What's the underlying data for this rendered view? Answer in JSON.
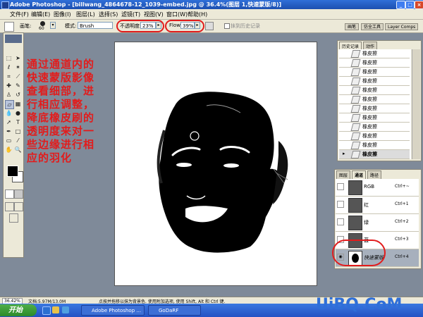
{
  "window": {
    "title": "Adobe Photoshop - [billwang_4864678-12_1039-embed.jpg @ 36.4%(图层 1,快速蒙版/8)]"
  },
  "menus": [
    "文件(F)",
    "编辑(E)",
    "图像(I)",
    "图层(L)",
    "选择(S)",
    "滤镜(T)",
    "视图(V)",
    "窗口(W)",
    "帮助(H)"
  ],
  "options": {
    "brush_label": "画笔:",
    "brush_size": "60",
    "mode_label": "模式:",
    "mode_value": "Brush",
    "opacity_label": "不透明度:",
    "opacity_value": "23%",
    "flow_label": "Flow:",
    "flow_value": "39%",
    "erase_history_label": "抹到历史记录"
  },
  "palette_tabs": [
    "画笔",
    "仿全工具",
    "Layer Comps"
  ],
  "annotation": [
    "通过通道内的",
    "快速蒙版影像",
    "查看细部，进",
    "行相应调整，",
    "降底橡皮刷的",
    "透明度来对一",
    "些边缘进行相",
    "应的羽化"
  ],
  "history_panel": {
    "tabs": [
      "历史记录",
      "动作"
    ],
    "items": [
      "橡皮擦",
      "橡皮擦",
      "橡皮擦",
      "橡皮擦",
      "橡皮擦",
      "橡皮擦",
      "橡皮擦",
      "橡皮擦",
      "橡皮擦",
      "橡皮擦",
      "橡皮擦",
      "橡皮擦"
    ],
    "current_index": 11
  },
  "channels_panel": {
    "tabs": [
      "图层",
      "通道",
      "路径"
    ],
    "channels": [
      {
        "name": "RGB",
        "shortcut": "Ctrl+~"
      },
      {
        "name": "红",
        "shortcut": "Ctrl+1"
      },
      {
        "name": "绿",
        "shortcut": "Ctrl+2"
      },
      {
        "name": "蓝",
        "shortcut": "Ctrl+3"
      },
      {
        "name": "快速蒙版",
        "shortcut": "Ctrl+4"
      }
    ],
    "active_channel": "快速蒙版"
  },
  "status": {
    "zoom": "36.42%",
    "doc": "文档:5.97M/13.0M",
    "hint": "点按并拖移以抹为背景色. 使用附加选项, 使用 Shift, Alt 和 Ctrl 键."
  },
  "taskbar": {
    "start_label": "开始",
    "buttons": [
      "Adobe Photoshop ...",
      "GoDaRF"
    ]
  },
  "watermark": "UiBQ.CoM",
  "colors": {
    "annotation": "#e21c1c",
    "highlight_ring": "#e21c1c",
    "watermark": "#2f6fd8"
  }
}
